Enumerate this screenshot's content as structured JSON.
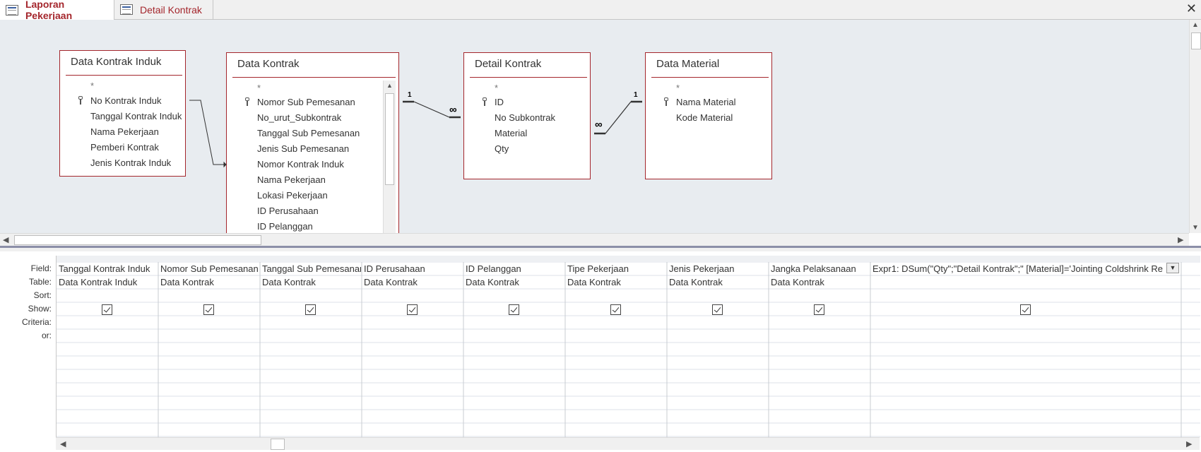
{
  "tabs": [
    {
      "label": "Laporan Pekerjaan",
      "active": true
    },
    {
      "label": "Detail Kontrak",
      "active": false
    }
  ],
  "close_symbol": "✕",
  "tables": [
    {
      "title": "Data Kontrak Induk",
      "fields": [
        "*",
        "No Kontrak Induk",
        "Tanggal Kontrak Induk",
        "Nama Pekerjaan",
        "Pemberi Kontrak",
        "Jenis Kontrak Induk"
      ]
    },
    {
      "title": "Data Kontrak",
      "fields": [
        "*",
        "Nomor Sub Pemesanan",
        "No_urut_Subkontrak",
        "Tanggal Sub Pemesanan",
        "Jenis Sub Pemesanan",
        "Nomor Kontrak Induk",
        "Nama Pekerjaan",
        "Lokasi Pekerjaan",
        "ID Perusahaan",
        "ID Pelanggan"
      ]
    },
    {
      "title": "Detail Kontrak",
      "fields": [
        "*",
        "ID",
        "No Subkontrak",
        "Material",
        "Qty"
      ]
    },
    {
      "title": "Data Material",
      "fields": [
        "*",
        "Nama Material",
        "Kode Material"
      ]
    }
  ],
  "relationships": [
    {
      "one_label": "1",
      "many_label": "∞"
    },
    {
      "one_label": "1",
      "many_label": "∞"
    }
  ],
  "grid": {
    "row_labels": [
      "Field:",
      "Table:",
      "Sort:",
      "Show:",
      "Criteria:",
      "or:"
    ],
    "columns": [
      {
        "field": "Tanggal Kontrak Induk",
        "table": "Data Kontrak Induk",
        "show": true
      },
      {
        "field": "Nomor Sub Pemesanan",
        "table": "Data Kontrak",
        "show": true
      },
      {
        "field": "Tanggal Sub Pemesanan",
        "table": "Data Kontrak",
        "show": true
      },
      {
        "field": "ID Perusahaan",
        "table": "Data Kontrak",
        "show": true
      },
      {
        "field": "ID Pelanggan",
        "table": "Data Kontrak",
        "show": true
      },
      {
        "field": "Tipe Pekerjaan",
        "table": "Data Kontrak",
        "show": true
      },
      {
        "field": "Jenis Pekerjaan",
        "table": "Data Kontrak",
        "show": true
      },
      {
        "field": "Jangka Pelaksanaan",
        "table": "Data Kontrak",
        "show": true
      },
      {
        "field": "Expr1: DSum(\"Qty\";\"Detail Kontrak\";\" [Material]='Jointing Coldshrink Re",
        "table": "",
        "show": true
      }
    ]
  }
}
